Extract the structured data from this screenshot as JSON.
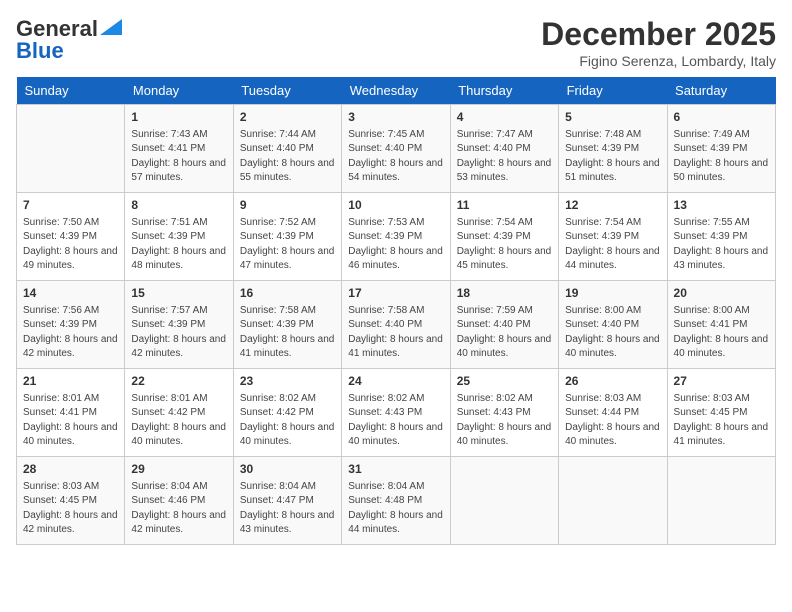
{
  "header": {
    "logo_line1": "General",
    "logo_line2": "Blue",
    "month": "December 2025",
    "location": "Figino Serenza, Lombardy, Italy"
  },
  "weekdays": [
    "Sunday",
    "Monday",
    "Tuesday",
    "Wednesday",
    "Thursday",
    "Friday",
    "Saturday"
  ],
  "weeks": [
    [
      {
        "day": "",
        "sunrise": "",
        "sunset": "",
        "daylight": ""
      },
      {
        "day": "1",
        "sunrise": "Sunrise: 7:43 AM",
        "sunset": "Sunset: 4:41 PM",
        "daylight": "Daylight: 8 hours and 57 minutes."
      },
      {
        "day": "2",
        "sunrise": "Sunrise: 7:44 AM",
        "sunset": "Sunset: 4:40 PM",
        "daylight": "Daylight: 8 hours and 55 minutes."
      },
      {
        "day": "3",
        "sunrise": "Sunrise: 7:45 AM",
        "sunset": "Sunset: 4:40 PM",
        "daylight": "Daylight: 8 hours and 54 minutes."
      },
      {
        "day": "4",
        "sunrise": "Sunrise: 7:47 AM",
        "sunset": "Sunset: 4:40 PM",
        "daylight": "Daylight: 8 hours and 53 minutes."
      },
      {
        "day": "5",
        "sunrise": "Sunrise: 7:48 AM",
        "sunset": "Sunset: 4:39 PM",
        "daylight": "Daylight: 8 hours and 51 minutes."
      },
      {
        "day": "6",
        "sunrise": "Sunrise: 7:49 AM",
        "sunset": "Sunset: 4:39 PM",
        "daylight": "Daylight: 8 hours and 50 minutes."
      }
    ],
    [
      {
        "day": "7",
        "sunrise": "Sunrise: 7:50 AM",
        "sunset": "Sunset: 4:39 PM",
        "daylight": "Daylight: 8 hours and 49 minutes."
      },
      {
        "day": "8",
        "sunrise": "Sunrise: 7:51 AM",
        "sunset": "Sunset: 4:39 PM",
        "daylight": "Daylight: 8 hours and 48 minutes."
      },
      {
        "day": "9",
        "sunrise": "Sunrise: 7:52 AM",
        "sunset": "Sunset: 4:39 PM",
        "daylight": "Daylight: 8 hours and 47 minutes."
      },
      {
        "day": "10",
        "sunrise": "Sunrise: 7:53 AM",
        "sunset": "Sunset: 4:39 PM",
        "daylight": "Daylight: 8 hours and 46 minutes."
      },
      {
        "day": "11",
        "sunrise": "Sunrise: 7:54 AM",
        "sunset": "Sunset: 4:39 PM",
        "daylight": "Daylight: 8 hours and 45 minutes."
      },
      {
        "day": "12",
        "sunrise": "Sunrise: 7:54 AM",
        "sunset": "Sunset: 4:39 PM",
        "daylight": "Daylight: 8 hours and 44 minutes."
      },
      {
        "day": "13",
        "sunrise": "Sunrise: 7:55 AM",
        "sunset": "Sunset: 4:39 PM",
        "daylight": "Daylight: 8 hours and 43 minutes."
      }
    ],
    [
      {
        "day": "14",
        "sunrise": "Sunrise: 7:56 AM",
        "sunset": "Sunset: 4:39 PM",
        "daylight": "Daylight: 8 hours and 42 minutes."
      },
      {
        "day": "15",
        "sunrise": "Sunrise: 7:57 AM",
        "sunset": "Sunset: 4:39 PM",
        "daylight": "Daylight: 8 hours and 42 minutes."
      },
      {
        "day": "16",
        "sunrise": "Sunrise: 7:58 AM",
        "sunset": "Sunset: 4:39 PM",
        "daylight": "Daylight: 8 hours and 41 minutes."
      },
      {
        "day": "17",
        "sunrise": "Sunrise: 7:58 AM",
        "sunset": "Sunset: 4:40 PM",
        "daylight": "Daylight: 8 hours and 41 minutes."
      },
      {
        "day": "18",
        "sunrise": "Sunrise: 7:59 AM",
        "sunset": "Sunset: 4:40 PM",
        "daylight": "Daylight: 8 hours and 40 minutes."
      },
      {
        "day": "19",
        "sunrise": "Sunrise: 8:00 AM",
        "sunset": "Sunset: 4:40 PM",
        "daylight": "Daylight: 8 hours and 40 minutes."
      },
      {
        "day": "20",
        "sunrise": "Sunrise: 8:00 AM",
        "sunset": "Sunset: 4:41 PM",
        "daylight": "Daylight: 8 hours and 40 minutes."
      }
    ],
    [
      {
        "day": "21",
        "sunrise": "Sunrise: 8:01 AM",
        "sunset": "Sunset: 4:41 PM",
        "daylight": "Daylight: 8 hours and 40 minutes."
      },
      {
        "day": "22",
        "sunrise": "Sunrise: 8:01 AM",
        "sunset": "Sunset: 4:42 PM",
        "daylight": "Daylight: 8 hours and 40 minutes."
      },
      {
        "day": "23",
        "sunrise": "Sunrise: 8:02 AM",
        "sunset": "Sunset: 4:42 PM",
        "daylight": "Daylight: 8 hours and 40 minutes."
      },
      {
        "day": "24",
        "sunrise": "Sunrise: 8:02 AM",
        "sunset": "Sunset: 4:43 PM",
        "daylight": "Daylight: 8 hours and 40 minutes."
      },
      {
        "day": "25",
        "sunrise": "Sunrise: 8:02 AM",
        "sunset": "Sunset: 4:43 PM",
        "daylight": "Daylight: 8 hours and 40 minutes."
      },
      {
        "day": "26",
        "sunrise": "Sunrise: 8:03 AM",
        "sunset": "Sunset: 4:44 PM",
        "daylight": "Daylight: 8 hours and 40 minutes."
      },
      {
        "day": "27",
        "sunrise": "Sunrise: 8:03 AM",
        "sunset": "Sunset: 4:45 PM",
        "daylight": "Daylight: 8 hours and 41 minutes."
      }
    ],
    [
      {
        "day": "28",
        "sunrise": "Sunrise: 8:03 AM",
        "sunset": "Sunset: 4:45 PM",
        "daylight": "Daylight: 8 hours and 42 minutes."
      },
      {
        "day": "29",
        "sunrise": "Sunrise: 8:04 AM",
        "sunset": "Sunset: 4:46 PM",
        "daylight": "Daylight: 8 hours and 42 minutes."
      },
      {
        "day": "30",
        "sunrise": "Sunrise: 8:04 AM",
        "sunset": "Sunset: 4:47 PM",
        "daylight": "Daylight: 8 hours and 43 minutes."
      },
      {
        "day": "31",
        "sunrise": "Sunrise: 8:04 AM",
        "sunset": "Sunset: 4:48 PM",
        "daylight": "Daylight: 8 hours and 44 minutes."
      },
      {
        "day": "",
        "sunrise": "",
        "sunset": "",
        "daylight": ""
      },
      {
        "day": "",
        "sunrise": "",
        "sunset": "",
        "daylight": ""
      },
      {
        "day": "",
        "sunrise": "",
        "sunset": "",
        "daylight": ""
      }
    ]
  ]
}
